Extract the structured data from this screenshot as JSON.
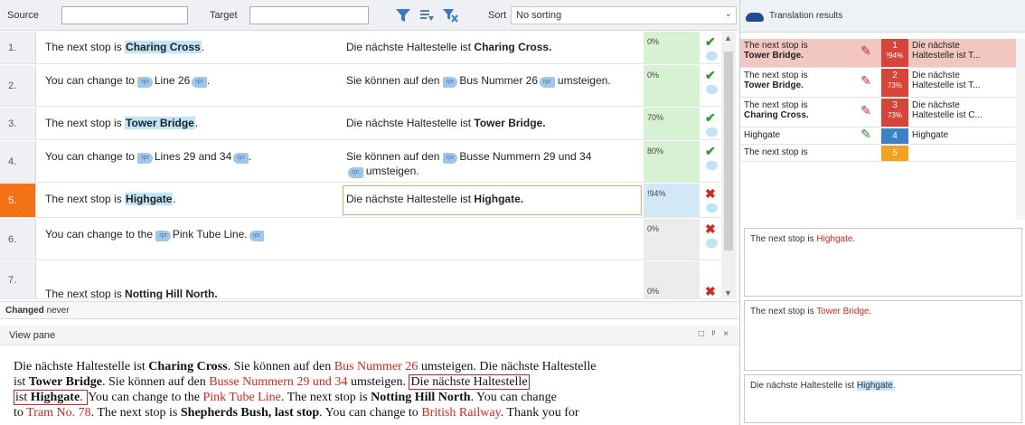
{
  "filter": {
    "source_label": "Source",
    "target_label": "Target",
    "sort_label": "Sort",
    "sort_value": "No sorting"
  },
  "rows": [
    {
      "num": "1.",
      "match": "0%",
      "status": "ok"
    },
    {
      "num": "2.",
      "match": "0%",
      "status": "ok"
    },
    {
      "num": "3.",
      "match": "70%",
      "status": "ok"
    },
    {
      "num": "4.",
      "match": "80%",
      "status": "ok"
    },
    {
      "num": "5.",
      "match": "!94%",
      "status": "bad"
    },
    {
      "num": "6.",
      "match": "0%",
      "status": "bad"
    },
    {
      "num": "7.",
      "match": "0%",
      "status": "bad"
    }
  ],
  "row_text": {
    "r1_src_a": "The next stop is ",
    "r1_src_b": "Charing Cross",
    "r1_src_c": ".",
    "r1_tgt_a": "Die nächste Haltestelle ist ",
    "r1_tgt_b": "Charing Cross.",
    "r2_src_a": "You can change to ",
    "r2_src_b": "Line 26",
    "r2_src_c": ".",
    "r2_tgt_a": "Sie können auf den ",
    "r2_tgt_b": "Bus Nummer 26",
    "r2_tgt_c": " umsteigen.",
    "r3_src_a": "The next stop is ",
    "r3_src_b": "Tower Bridge",
    "r3_src_c": ".",
    "r3_tgt_a": "Die nächste Haltestelle ist ",
    "r3_tgt_b": "Tower Bridge.",
    "r4_src_a": "You can change to ",
    "r4_src_b": "Lines 29 and 34",
    "r4_src_c": ".",
    "r4_tgt_a": "Sie können auf den ",
    "r4_tgt_b": "Busse Nummern 29 und 34",
    "r4_tgt_c": " umsteigen.",
    "r5_src_a": "The next stop is ",
    "r5_src_b": "Highgate",
    "r5_src_c": ".",
    "r5_tgt_a": "Die nächste Haltestelle ist ",
    "r5_tgt_b": "Highgate.",
    "r6_src_a": "You can change to the ",
    "r6_src_b": "Pink Tube Line.",
    "r7_src_a": "The next stop is ",
    "r7_src_b": "Notting Hill North."
  },
  "tag_label": "rpr",
  "changed": {
    "label": "Changed",
    "value": "never"
  },
  "view_pane": {
    "title": "View pane",
    "controls": "□ ᵖ ×",
    "p1": "Die nächste Haltestelle ist ",
    "p2": "Charing Cross",
    "p3": ". Sie können auf den ",
    "p4": "Bus Nummer 26",
    "p5": " umsteigen. Die nächste Haltestelle",
    "p6": "ist ",
    "p7": "Tower Bridge",
    "p8": ". Sie können auf den ",
    "p9": "Busse Nummern 29 und 34",
    "p10": " umsteigen. ",
    "p11": "Die nächste Haltestelle",
    "p12": "ist ",
    "p13": "Highgate",
    "p14": ". ",
    "p15": "You can change to the ",
    "p16": "Pink Tube Line",
    "p17": ". The next stop is ",
    "p18": "Notting Hill North",
    "p19": ". You can change",
    "p20": "to ",
    "p21": "Tram No. 78",
    "p22": ". The next stop is ",
    "p23": "Shepherds Bush, last stop",
    "p24": ". You can change to ",
    "p25": "British Railway",
    "p26": ". Thank you for"
  },
  "translation_results": {
    "title": "Translation results",
    "items": [
      {
        "src_a": "The next stop is",
        "src_b": "Tower Bridge.",
        "num": "1",
        "pct": "!94%",
        "tgt_a": "Die nächste",
        "tgt_b": "Haltestelle ist T...",
        "color": "#d7453a",
        "pen": "red"
      },
      {
        "src_a": "The next stop is",
        "src_b": "Tower Bridge.",
        "num": "2",
        "pct": "73%",
        "tgt_a": "Die nächste",
        "tgt_b": "Haltestelle ist T...",
        "color": "#d7453a",
        "pen": "red"
      },
      {
        "src_a": "The next stop is",
        "src_b": "Charing Cross.",
        "num": "3",
        "pct": "73%",
        "tgt_a": "Die nächste",
        "tgt_b": "Haltestelle ist C...",
        "color": "#d7453a",
        "pen": "red"
      },
      {
        "src_a": "Highgate",
        "src_b": "",
        "num": "4",
        "pct": "",
        "tgt_a": "Highgate",
        "tgt_b": "",
        "color": "#3c82c8",
        "pen": "green"
      },
      {
        "src_a": "The next stop is",
        "src_b": "",
        "num": "5",
        "pct": "",
        "tgt_a": "",
        "tgt_b": "",
        "color": "#f2a21d",
        "pen": ""
      }
    ]
  },
  "preview": {
    "box1_a": "The next stop is ",
    "box1_b": "Highgate",
    "box1_c": ".",
    "box2_a": "The next stop is ",
    "box2_b": "Tower Bridge",
    "box2_c": ".",
    "box3_a": "Die nächste Haltestelle ist ",
    "box3_b": "Highgate",
    "box3_c": "."
  }
}
